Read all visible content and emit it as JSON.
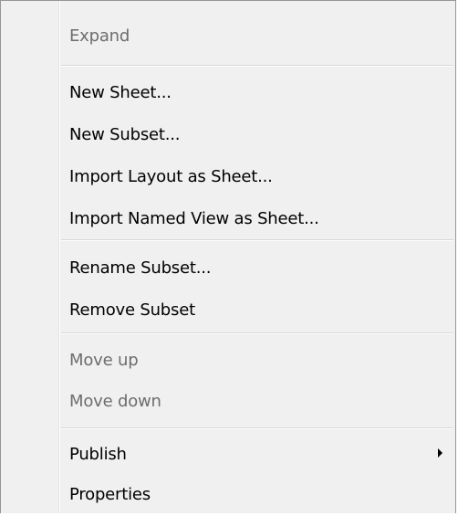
{
  "menu": {
    "items": [
      {
        "label": "Expand",
        "disabled": true
      },
      {
        "label": "New Sheet..."
      },
      {
        "label": "New Subset..."
      },
      {
        "label": "Import Layout as Sheet..."
      },
      {
        "label": "Import Named View as Sheet..."
      },
      {
        "label": "Rename Subset..."
      },
      {
        "label": "Remove Subset"
      },
      {
        "label": "Move up",
        "disabled": true
      },
      {
        "label": "Move down",
        "disabled": true
      },
      {
        "label": "Publish",
        "submenu": true
      },
      {
        "label": "Properties"
      }
    ]
  },
  "colors": {
    "background": "#f0f0f0",
    "border": "#979797",
    "disabled_text": "#6d6d6d",
    "separator": "#d7d7d7"
  }
}
